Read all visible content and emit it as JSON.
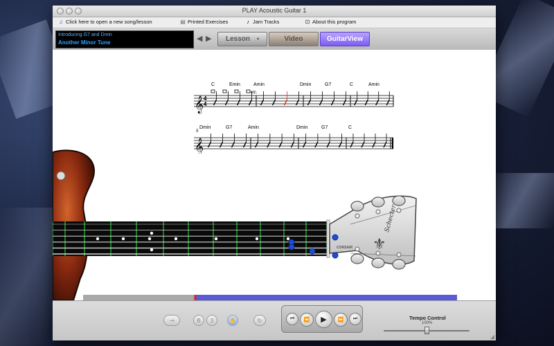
{
  "window": {
    "title": "PLAY Acoustic Guitar 1"
  },
  "menu": {
    "open_song": "Click here to open a new song/lesson",
    "printed_exercises": "Printed Exercises",
    "jam_tracks": "Jam Tracks",
    "about": "About this program"
  },
  "song": {
    "lesson_title": "Introducing G7 and Dmin",
    "song_title": "Another Minor Tune"
  },
  "nav": {
    "lesson": "Lesson",
    "video": "Video",
    "guitarview": "GuitarView"
  },
  "sheet": {
    "row1_chords": [
      "C",
      "Emin",
      "Amin",
      "Dmin",
      "G7",
      "C",
      "Amin"
    ],
    "row2_chords": [
      "Dmin",
      "G7",
      "Amin",
      "Dmin",
      "G7",
      "C"
    ],
    "etc_label": "etc.",
    "measure_number": "5"
  },
  "guitar": {
    "brand": "CORSAIR",
    "headstock_logo": "Schecter"
  },
  "playback": {
    "progress": 0.3,
    "progress_color": "#5b5bd6",
    "remaining_color": "#a9a9a9",
    "marker_color": "#e02020"
  },
  "controls": {
    "small_b_label": "B",
    "small_3_label": "3"
  },
  "tempo": {
    "label": "Tempo Control",
    "value": "100%",
    "position": 0.5
  },
  "colors": {
    "note_blue": "#1e4ed8",
    "fret_green": "#20b030",
    "accent_purple": "#7c5cf2"
  },
  "icons": {
    "menu_open": "note-doc-icon",
    "printed": "document-icon",
    "jam": "music-note-icon",
    "about": "info-icon"
  }
}
